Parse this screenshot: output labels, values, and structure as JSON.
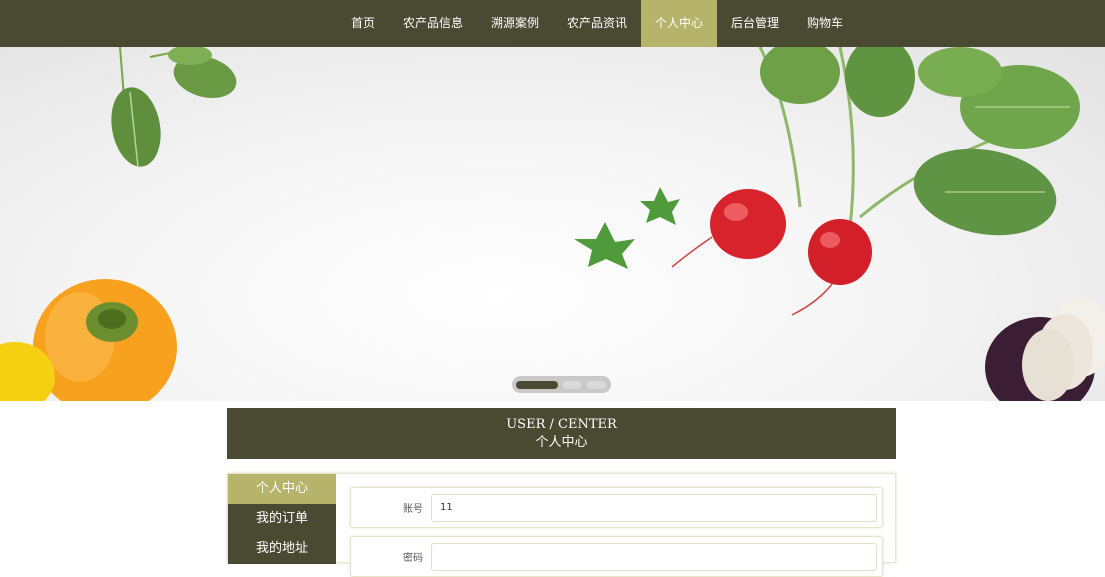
{
  "nav": {
    "items": [
      {
        "label": "首页",
        "name": "nav-home"
      },
      {
        "label": "农产品信息",
        "name": "nav-products"
      },
      {
        "label": "溯源案例",
        "name": "nav-trace-cases"
      },
      {
        "label": "农产品资讯",
        "name": "nav-news"
      },
      {
        "label": "个人中心",
        "name": "nav-user-center",
        "active": true
      },
      {
        "label": "后台管理",
        "name": "nav-admin"
      },
      {
        "label": "购物车",
        "name": "nav-cart"
      }
    ]
  },
  "carousel": {
    "slide_count": 3,
    "active_index": 0
  },
  "center": {
    "title_en": "USER / CENTER",
    "title_zh": "个人中心"
  },
  "sidebar": {
    "items": [
      {
        "label": "个人中心",
        "active": true
      },
      {
        "label": "我的订单"
      },
      {
        "label": "我的地址"
      }
    ]
  },
  "form": {
    "account_label": "账号",
    "account_value": "11",
    "password_label": "密码",
    "password_value": ""
  },
  "colors": {
    "nav_bg": "#4a4a33",
    "accent": "#b6b36a"
  }
}
